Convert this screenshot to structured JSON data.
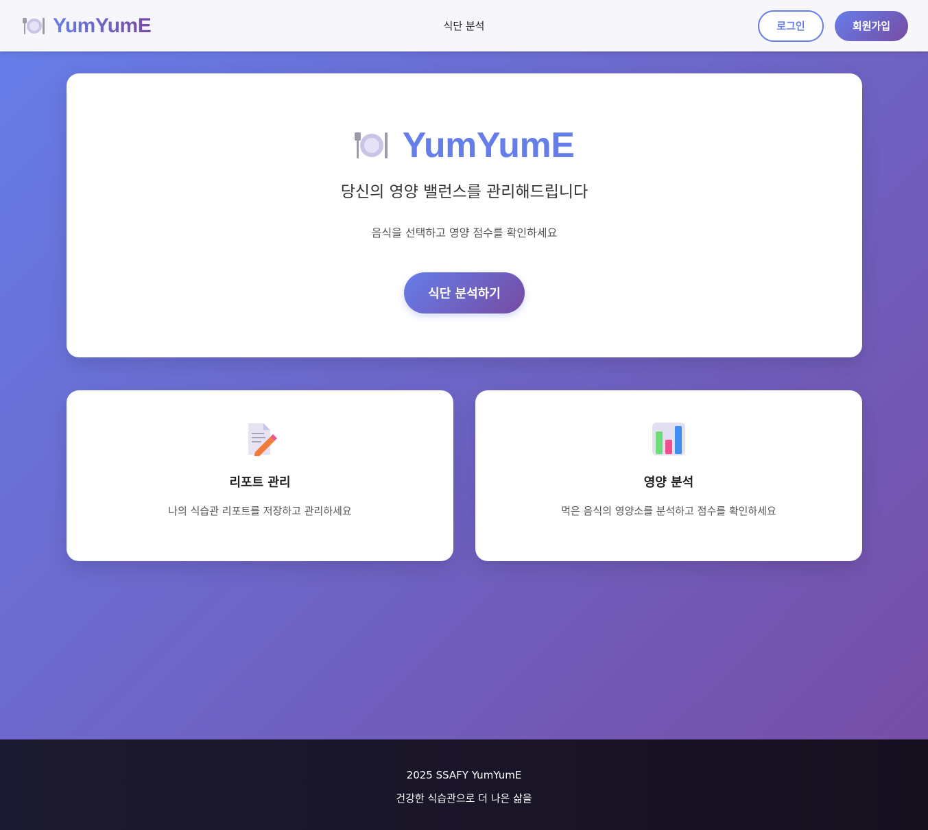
{
  "header": {
    "brand": "YumYumE",
    "brand_icon": "plate-cutlery-icon",
    "nav": {
      "analysis_link": "식단 분석"
    },
    "login_label": "로그인",
    "signup_label": "회원가입"
  },
  "hero": {
    "icon": "plate-cutlery-icon",
    "title": "YumYumE",
    "subtitle": "당신의 영양 밸런스를 관리해드립니다",
    "description": "음식을 선택하고 영양 점수를 확인하세요",
    "cta_label": "식단 분석하기"
  },
  "features": [
    {
      "icon": "memo-pencil-icon",
      "title": "리포트 관리",
      "description": "나의 식습관 리포트를 저장하고 관리하세요"
    },
    {
      "icon": "bar-chart-icon",
      "title": "영양 분석",
      "description": "먹은 음식의 영양소를 분석하고 점수를 확인하세요"
    }
  ],
  "footer": {
    "line1": "2025 SSAFY YumYumE",
    "line2": "건강한 식습관으로 더 나은 삶을"
  },
  "colors": {
    "gradient_start": "#667eea",
    "gradient_end": "#764ba2",
    "footer_bg": "#1c1a30"
  }
}
